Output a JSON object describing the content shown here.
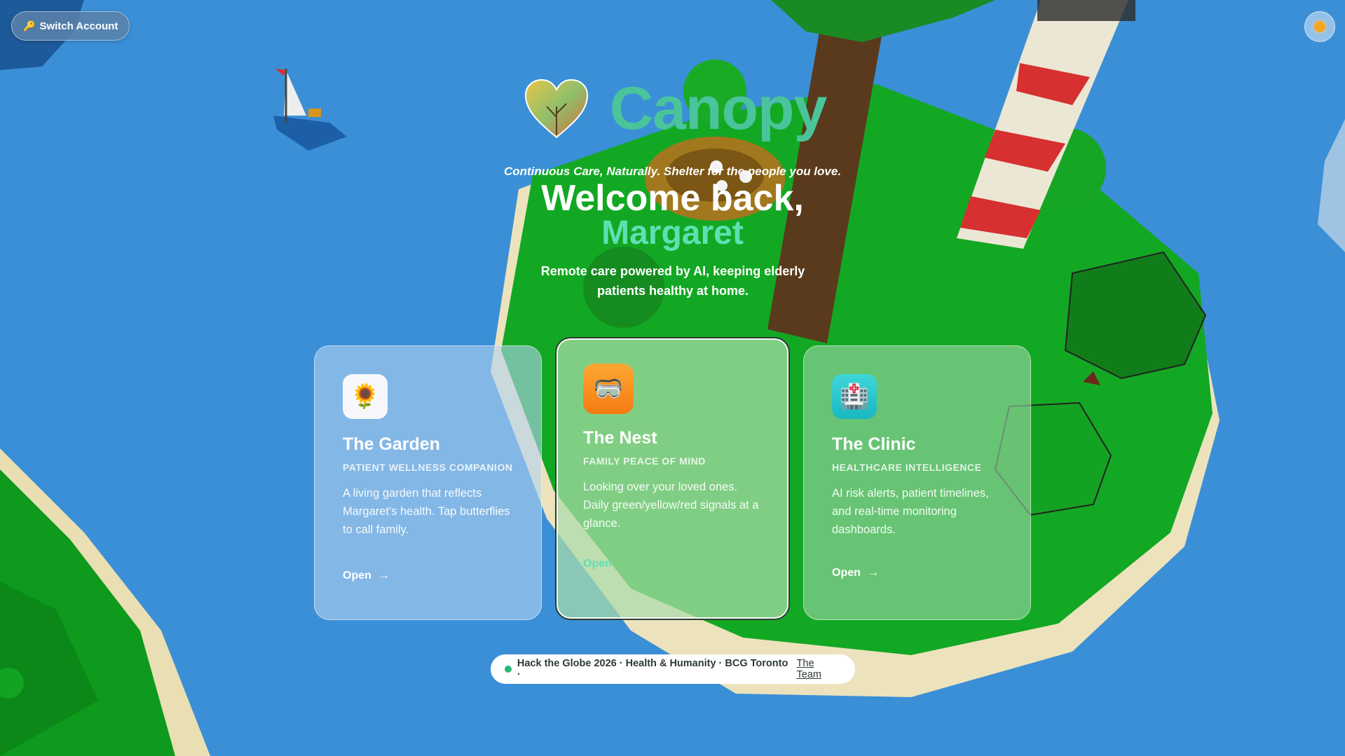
{
  "header": {
    "switch_account_label": "Switch Account"
  },
  "brand": {
    "title": "Canopy",
    "tagline": "Continuous Care, Naturally. Shelter for the people you love."
  },
  "hero": {
    "welcome": "Welcome back,",
    "name": "Margaret",
    "subtitle": "Remote care powered by AI, keeping elderly patients healthy at home."
  },
  "cards": [
    {
      "title": "The Garden",
      "subtitle": "PATIENT WELLNESS COMPANION",
      "description": "A living garden that reflects Margaret's health. Tap butterflies to call family.",
      "action": "Open",
      "icon": "wheelbarrow-icon"
    },
    {
      "title": "The Nest",
      "subtitle": "FAMILY PEACE OF MIND",
      "description": "Looking over your loved ones. Daily green/yellow/red signals at a glance.",
      "action": "Open",
      "icon": "nest-icon"
    },
    {
      "title": "The Clinic",
      "subtitle": "HEALTHCARE INTELLIGENCE",
      "description": "AI risk alerts, patient timelines, and real-time monitoring dashboards.",
      "action": "Open",
      "icon": "clinic-icon"
    }
  ],
  "footer": {
    "text": "Hack the Globe 2026 · Health & Humanity · BCG Toronto ·",
    "link": "The Team"
  },
  "colors": {
    "sky": "#3b8fd6",
    "brand_green": "#4ac49b",
    "accent_mint": "#5fe0b3",
    "grass": "#14a824",
    "status_dot": "#2bb673"
  }
}
